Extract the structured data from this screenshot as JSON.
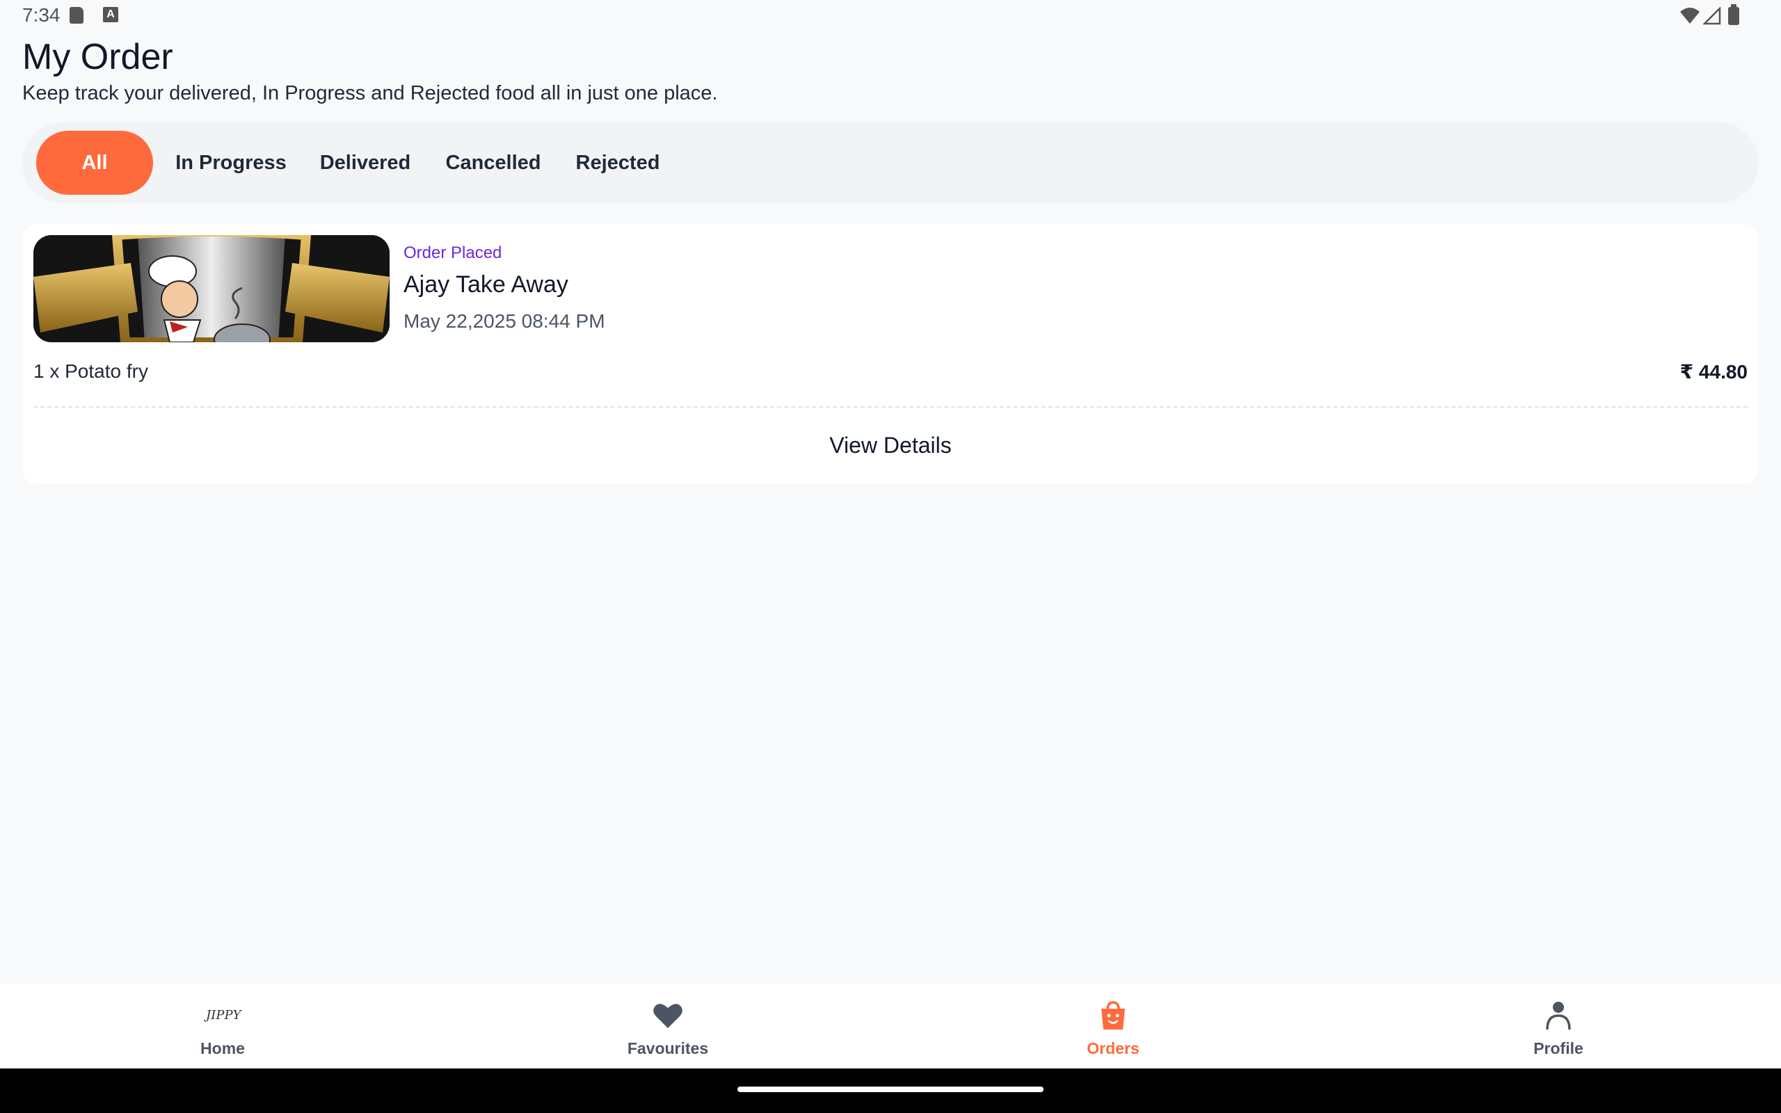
{
  "status_bar": {
    "time": "7:34",
    "icons": [
      "sd-card-icon",
      "keyboard-a-icon",
      "wifi-icon",
      "signal-icon",
      "battery-icon"
    ],
    "keyboard_glyph": "A"
  },
  "header": {
    "title": "My Order",
    "subtitle": "Keep track your delivered, In Progress and Rejected food all in just one place."
  },
  "tabs": [
    {
      "label": "All",
      "active": true
    },
    {
      "label": "In Progress",
      "active": false
    },
    {
      "label": "Delivered",
      "active": false
    },
    {
      "label": "Cancelled",
      "active": false
    },
    {
      "label": "Rejected",
      "active": false
    }
  ],
  "orders": [
    {
      "status": "Order Placed",
      "restaurant": "Ajay Take Away",
      "date": "May 22,2025 08:44 PM",
      "items": "1 x Potato fry",
      "price": "₹ 44.80",
      "action_label": "View Details"
    }
  ],
  "bottom_nav": [
    {
      "label": "Home",
      "icon": "jippy-logo-icon",
      "logo_text": "JIPPY",
      "active": false
    },
    {
      "label": "Favourites",
      "icon": "heart-icon",
      "active": false
    },
    {
      "label": "Orders",
      "icon": "shopping-bag-icon",
      "active": true
    },
    {
      "label": "Profile",
      "icon": "person-icon",
      "active": false
    }
  ],
  "colors": {
    "accent": "#fe6a3c",
    "status_purple": "#6d28d9",
    "background": "#f8f9fb",
    "tab_track": "#f1f3f5",
    "nav_inactive": "#4b5563"
  }
}
